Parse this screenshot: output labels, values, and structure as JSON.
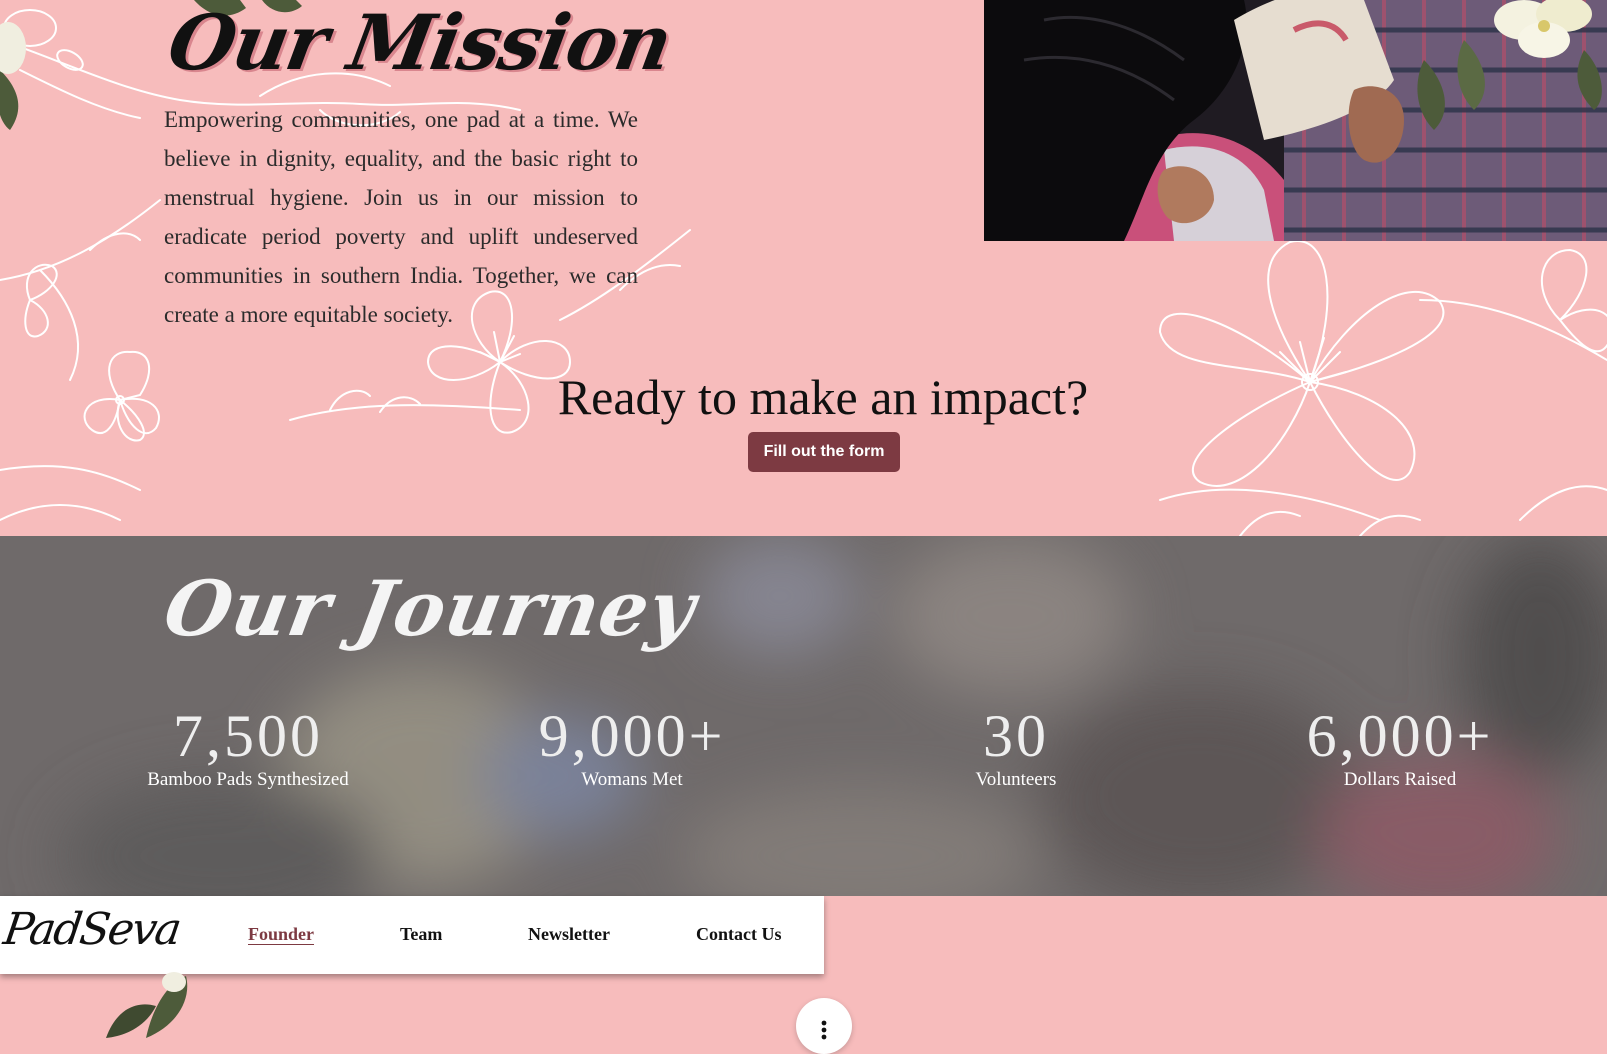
{
  "mission": {
    "title": "Our Mission",
    "body": "Empowering communities, one pad at a time. We believe in dignity, equality, and the basic right to menstrual hygiene. Join us in our mission to eradicate period poverty and uplift undeserved communities in southern India. Together, we can create a more equitable society.",
    "cta_heading": "Ready to make an impact?",
    "cta_button": "Fill out the form"
  },
  "journey": {
    "title": "Our Journey",
    "stats": [
      {
        "value": "7,500",
        "label": "Bamboo Pads Synthesized"
      },
      {
        "value": "9,000+",
        "label": "Womans Met"
      },
      {
        "value": "30",
        "label": "Volunteers"
      },
      {
        "value": "6,000+",
        "label": "Dollars Raised"
      }
    ]
  },
  "nav": {
    "logo": "PadSeva",
    "links": [
      "Founder",
      "Team",
      "Newsletter",
      "Contact Us"
    ],
    "active": "Founder"
  },
  "icons": {
    "menu": "more-vertical-icon"
  },
  "colors": {
    "page_pink": "#f7bcbc",
    "accent_maroon": "#7d3a42",
    "journey_overlay": "#716c6c",
    "white": "#ffffff"
  }
}
